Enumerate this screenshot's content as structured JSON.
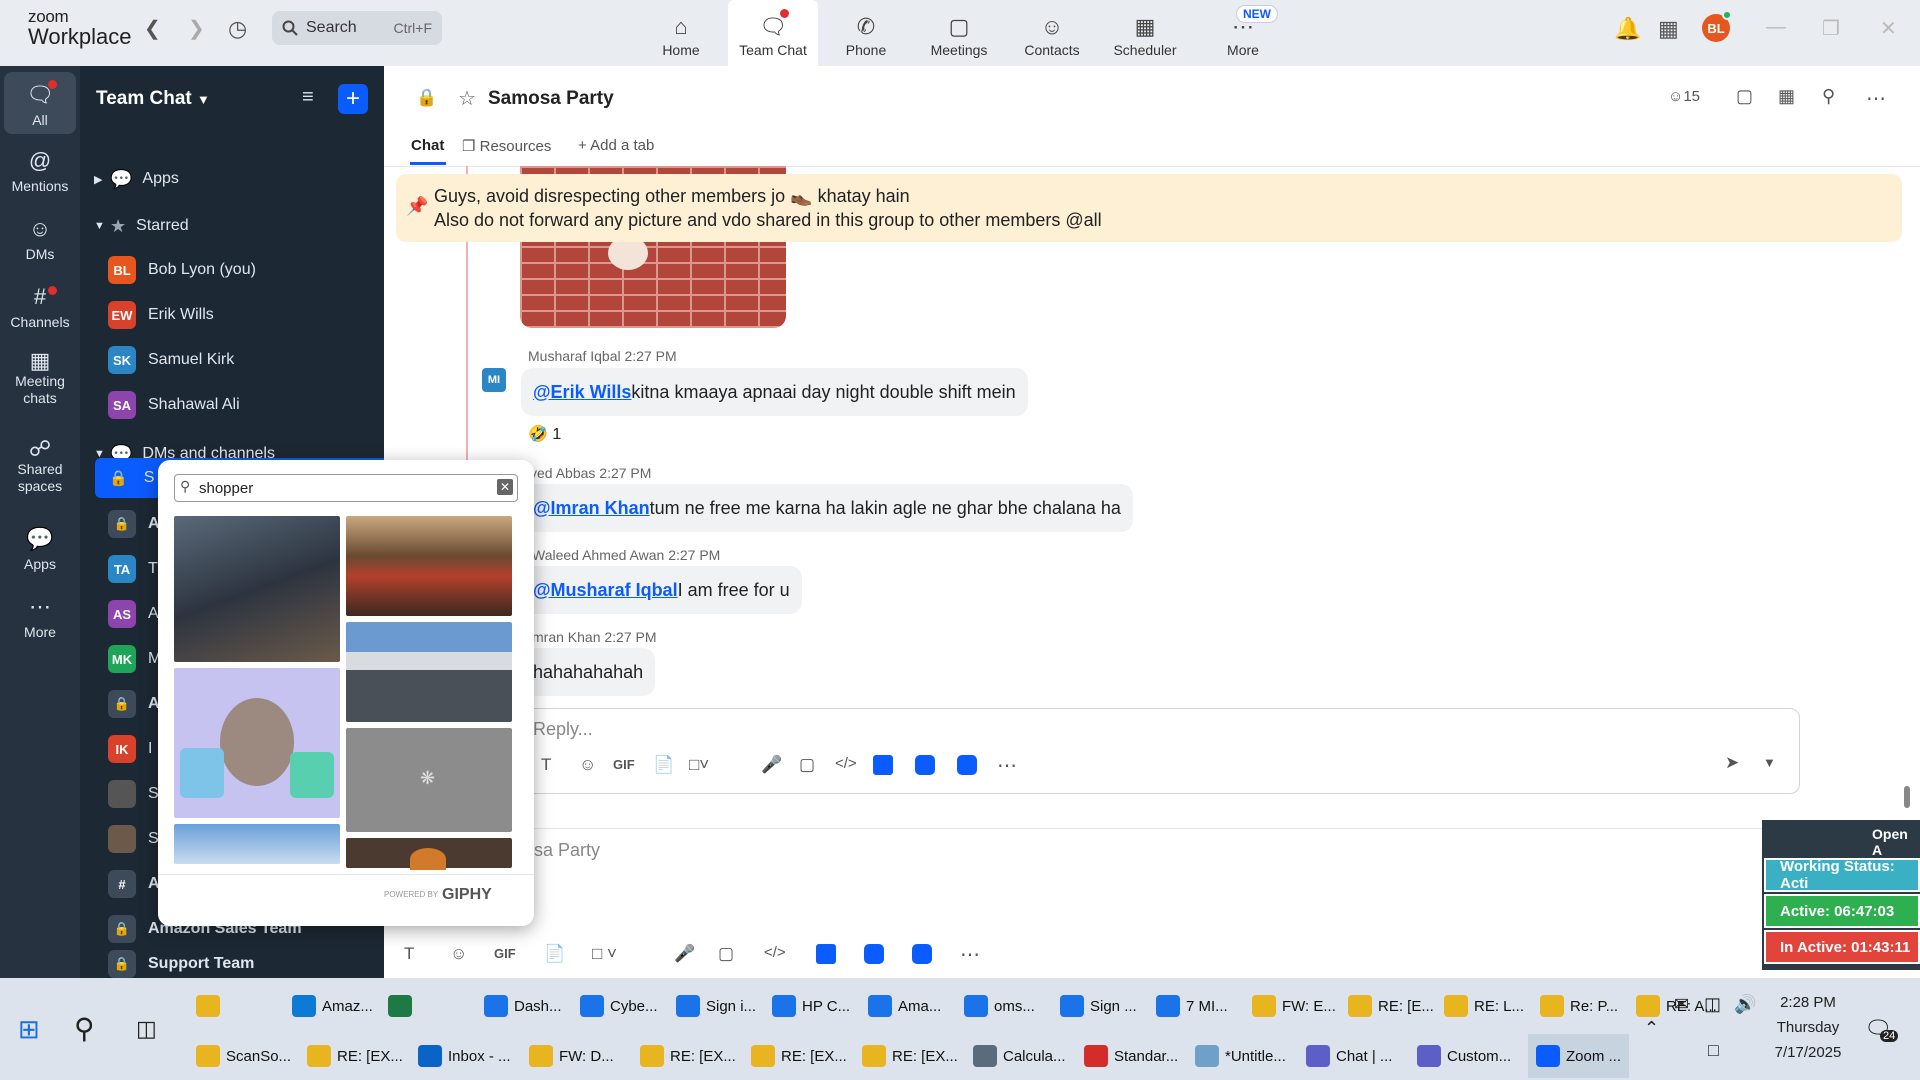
{
  "app": {
    "logo_top": "zoom",
    "logo_bottom": "Workplace"
  },
  "topbar": {
    "search_placeholder": "Search",
    "search_shortcut": "Ctrl+F",
    "nav": [
      {
        "label": "Home",
        "icon": "home-icon"
      },
      {
        "label": "Team Chat",
        "icon": "chat-icon"
      },
      {
        "label": "Phone",
        "icon": "phone-icon"
      },
      {
        "label": "Meetings",
        "icon": "video-icon"
      },
      {
        "label": "Contacts",
        "icon": "contacts-icon"
      },
      {
        "label": "Scheduler",
        "icon": "calendar-icon"
      },
      {
        "label": "More",
        "icon": "more-icon"
      }
    ],
    "new_badge": "NEW",
    "avatar": "BL"
  },
  "rail": [
    {
      "label": "All",
      "icon": "chat-icon"
    },
    {
      "label": "Mentions",
      "icon": "at-icon"
    },
    {
      "label": "DMs",
      "icon": "people-icon"
    },
    {
      "label": "Channels",
      "icon": "hash-icon"
    },
    {
      "label": "Meeting chats",
      "icon": "calendar-icon"
    },
    {
      "label": "Shared spaces",
      "icon": "share-icon"
    },
    {
      "label": "Apps",
      "icon": "apps-icon"
    },
    {
      "label": "More",
      "icon": "more-icon"
    }
  ],
  "sidebar": {
    "title": "Team Chat",
    "apps": "Apps",
    "starred": "Starred",
    "starred_items": [
      {
        "initials": "BL",
        "name": "Bob Lyon (you)",
        "color": "#e8561f"
      },
      {
        "initials": "EW",
        "name": "Erik Wills",
        "color": "#d9412b"
      },
      {
        "initials": "SK",
        "name": "Samuel Kirk",
        "color": "#2b86c5"
      },
      {
        "initials": "SA",
        "name": "Shahawal Ali",
        "color": "#8e44ad"
      }
    ],
    "dms_header": "DMs and channels",
    "dms": [
      {
        "initials": "S",
        "name": "S"
      },
      {
        "initials": "",
        "name": "A"
      },
      {
        "initials": "TA",
        "name": "T"
      },
      {
        "initials": "AS",
        "name": "A"
      },
      {
        "initials": "MK",
        "name": "M"
      },
      {
        "initials": "",
        "name": "A"
      },
      {
        "initials": "IK",
        "name": "I"
      },
      {
        "initials": "",
        "name": "S"
      },
      {
        "initials": "",
        "name": "S"
      },
      {
        "initials": "#",
        "name": "A"
      },
      {
        "initials": "",
        "name": "Amazon Sales Team"
      },
      {
        "initials": "",
        "name": "Support Team"
      }
    ]
  },
  "channel": {
    "name": "Samosa Party",
    "members": "15",
    "tabs": [
      "Chat",
      "Resources",
      "Add a tab"
    ],
    "pinned_line1": "Guys, avoid disrespecting other members jo 👞 khatay hain",
    "pinned_line2": "Also do not forward any picture and vdo shared in this group to other members @all"
  },
  "messages": [
    {
      "sender": "Musharaf Iqbal",
      "time": "2:27 PM",
      "avatar": "MI",
      "mention": "@Erik Wills",
      "text": " kitna kmaaya apnaai day night double shift mein",
      "reaction": "🤣",
      "reaction_count": "1"
    },
    {
      "sender": "yed Abbas",
      "time": "2:27 PM",
      "mention": "@Imran Khan",
      "text": " tum ne free me karna ha lakin agle ne ghar bhe chalana ha"
    },
    {
      "sender": "Waleed Ahmed Awan",
      "time": "2:27 PM",
      "mention": "@Musharaf Iqbal",
      "text": " I am free for u"
    },
    {
      "sender": "mran Khan",
      "time": "2:27 PM",
      "mention": "",
      "text": "hahahahahah"
    }
  ],
  "reply": {
    "placeholder": "Reply...",
    "gif_label": "GIF"
  },
  "composer": {
    "placeholder": "sa Party",
    "gif_label": "GIF"
  },
  "giphy": {
    "query": "shopper",
    "powered": "POWERED BY",
    "brand": "GIPHY"
  },
  "widget": {
    "open": "Open A",
    "status": "Working Status: Acti",
    "active": "Active: 06:47:03",
    "inactive": "In Active: 01:43:11"
  },
  "taskbar": {
    "row1": [
      {
        "label": "",
        "color": "#e8b420",
        "icon": "folder-icon"
      },
      {
        "label": "Amaz...",
        "color": "#0c7bd6",
        "icon": "edge-icon"
      },
      {
        "label": "",
        "color": "#1d7a45",
        "icon": "excel-icon"
      },
      {
        "label": "Dash...",
        "color": "#1a73e8",
        "icon": "chrome-icon"
      },
      {
        "label": "Cybe...",
        "color": "#1a73e8",
        "icon": "chrome-icon"
      },
      {
        "label": "Sign i...",
        "color": "#1a73e8",
        "icon": "chrome-icon"
      },
      {
        "label": "HP C...",
        "color": "#1a73e8",
        "icon": "chrome-icon"
      },
      {
        "label": "Ama...",
        "color": "#1a73e8",
        "icon": "chrome-icon"
      },
      {
        "label": "oms...",
        "color": "#1a73e8",
        "icon": "chrome-icon"
      },
      {
        "label": "Sign ...",
        "color": "#1a73e8",
        "icon": "chrome-icon"
      },
      {
        "label": "7 MI...",
        "color": "#1a73e8",
        "icon": "chrome-icon"
      },
      {
        "label": "FW: E...",
        "color": "#e8b420",
        "icon": "mail-icon"
      },
      {
        "label": "RE: [E...",
        "color": "#e8b420",
        "icon": "mail-icon"
      },
      {
        "label": "RE: L...",
        "color": "#e8b420",
        "icon": "mail-icon"
      },
      {
        "label": "Re: P...",
        "color": "#e8b420",
        "icon": "mail-icon"
      },
      {
        "label": "RE: A...",
        "color": "#e8b420",
        "icon": "mail-icon"
      }
    ],
    "row2": [
      {
        "label": "ScanSo...",
        "color": "#e8b420",
        "icon": "mail-icon"
      },
      {
        "label": "RE: [EX...",
        "color": "#e8b420",
        "icon": "mail-icon"
      },
      {
        "label": "Inbox - ...",
        "color": "#0a64c8",
        "icon": "outlook-icon"
      },
      {
        "label": "FW: D...",
        "color": "#e8b420",
        "icon": "mail-icon"
      },
      {
        "label": "RE: [EX...",
        "color": "#e8b420",
        "icon": "mail-icon"
      },
      {
        "label": "RE: [EX...",
        "color": "#e8b420",
        "icon": "mail-icon"
      },
      {
        "label": "RE: [EX...",
        "color": "#e8b420",
        "icon": "mail-icon"
      },
      {
        "label": "Calcula...",
        "color": "#5a6b7b",
        "icon": "calculator-icon"
      },
      {
        "label": "Standar...",
        "color": "#d42b2b",
        "icon": "pdf-icon"
      },
      {
        "label": "*Untitle...",
        "color": "#6fa0c8",
        "icon": "paint-icon"
      },
      {
        "label": "Chat | ...",
        "color": "#5b5fc7",
        "icon": "teams-icon"
      },
      {
        "label": "Custom...",
        "color": "#5b5fc7",
        "icon": "teams-icon"
      },
      {
        "label": "Zoom ...",
        "color": "#0b5cff",
        "icon": "zoom-icon"
      }
    ],
    "time": "2:28 PM",
    "day": "Thursday",
    "date": "7/17/2025",
    "notif_count": "24"
  }
}
